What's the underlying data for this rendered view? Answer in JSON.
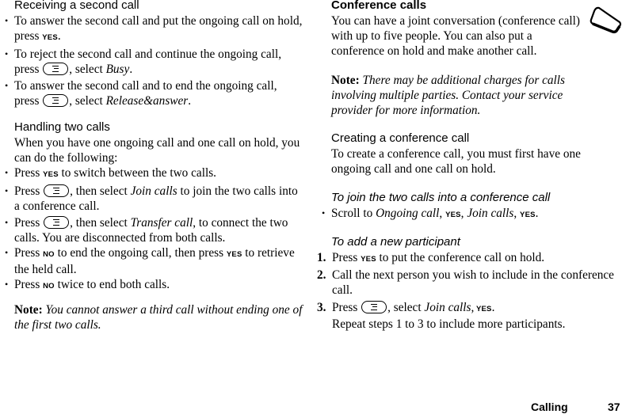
{
  "left": {
    "receiving": {
      "heading": "Receiving a second call",
      "bullets": [
        {
          "p1": "To answer the second call and put the ongoing call on hold, press ",
          "key": "YES",
          "p2": "."
        },
        {
          "p1": "To reject the second call and continue the ongoing call, press ",
          "p2": ", select ",
          "item": "Busy",
          "p3": "."
        },
        {
          "p1": "To answer the second call and to end the ongoing call, press ",
          "p2": ", select ",
          "item": "Release&answer",
          "p3": "."
        }
      ]
    },
    "handling": {
      "heading": "Handling two calls",
      "intro": "When you have one ongoing call and one call on hold, you can do the following:",
      "bullets": [
        {
          "p1": "Press ",
          "key": "YES",
          "p2": " to switch between the two calls."
        },
        {
          "p1": "Press ",
          "p2": ", then select ",
          "item": "Join calls",
          "p3": " to join the two calls into a conference call."
        },
        {
          "p1": "Press ",
          "p2": ", then select ",
          "item": "Transfer call",
          "p3": ", to connect the two calls. You are disconnected from both calls."
        },
        {
          "p1": "Press ",
          "key": "NO",
          "p2": " to end the ongoing call, then press ",
          "key2": "YES",
          "p3": " to retrieve the held call."
        },
        {
          "p1": "Press ",
          "key": "NO",
          "p2": " twice to end both calls."
        }
      ],
      "note_label": "Note:",
      "note_text": " You cannot answer a third call without ending one of the first two calls."
    }
  },
  "right": {
    "conference": {
      "heading": "Conference calls",
      "intro": "You can have a joint conversation (conference call) with up to five people. You can also put a conference on hold and make another call.",
      "note_label": "Note:",
      "note_text": " There may be additional charges for calls involving multiple parties. Contact your service provider for more information."
    },
    "creating": {
      "heading": "Creating a conference call",
      "intro": "To create a conference call, you must first have one ongoing call and one call on hold."
    },
    "join": {
      "heading": "To join the two calls into a conference call",
      "bullet": {
        "p1": "Scroll to ",
        "item1": "Ongoing call",
        "sep1": ", ",
        "key1": "YES",
        "sep2": ", ",
        "item2": "Join calls",
        "sep3": ", ",
        "key2": "YES",
        "end": "."
      }
    },
    "add": {
      "heading": "To add a new participant",
      "steps": [
        {
          "n": "1.",
          "p1": "Press ",
          "key": "YES",
          "p2": " to put the conference call on hold."
        },
        {
          "n": "2.",
          "p1": "Call the next person you wish to include in the conference call."
        },
        {
          "n": "3.",
          "p1": "Press ",
          "p2": ", select ",
          "item": "Join calls,",
          "key": " YES",
          "p3": "."
        }
      ],
      "repeat": "Repeat steps 1 to 3 to include more participants."
    }
  },
  "footer": {
    "section": "Calling",
    "page": "37"
  }
}
